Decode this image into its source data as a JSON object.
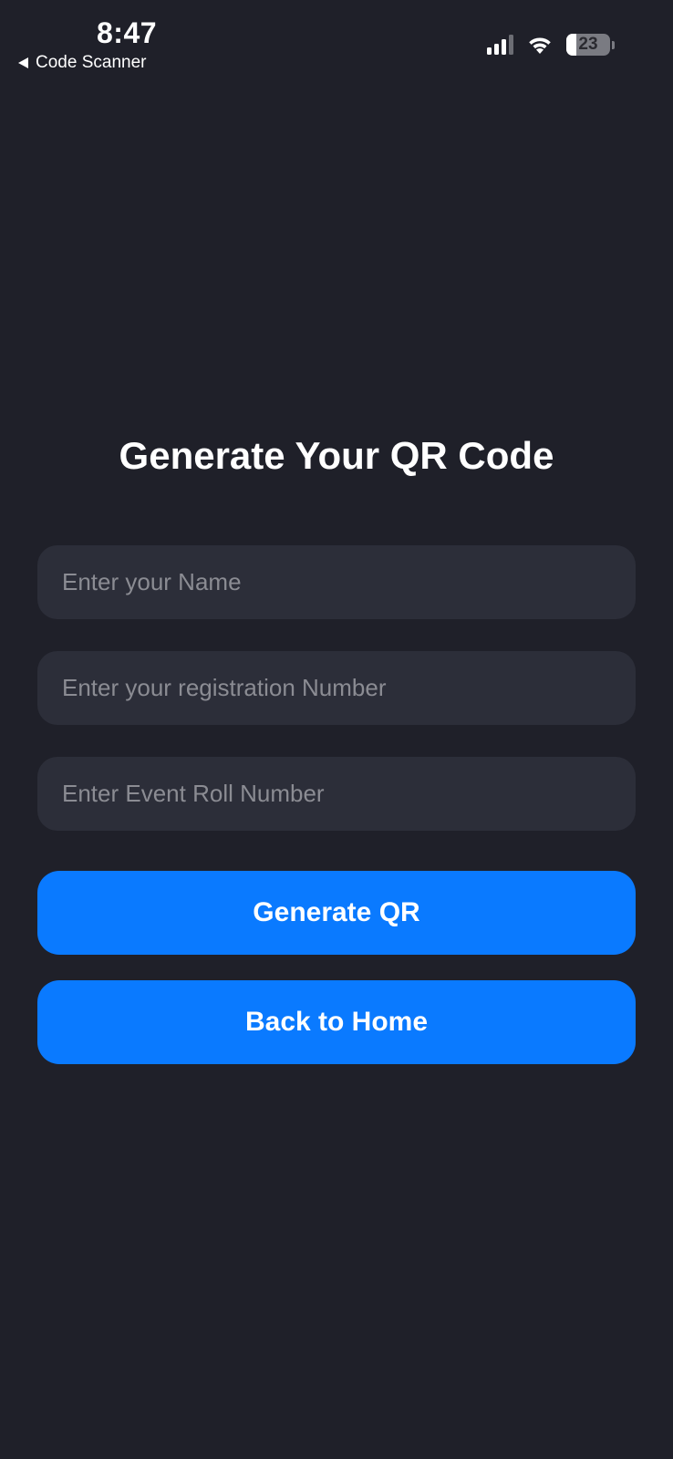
{
  "status_bar": {
    "time": "8:47",
    "back_app_label": "Code Scanner",
    "battery_level": "23",
    "battery_fraction": 0.23
  },
  "screen": {
    "title": "Generate Your QR Code",
    "fields": [
      {
        "placeholder": "Enter your Name",
        "value": ""
      },
      {
        "placeholder": "Enter your registration Number",
        "value": ""
      },
      {
        "placeholder": "Enter Event Roll Number",
        "value": ""
      }
    ],
    "buttons": {
      "generate": "Generate QR",
      "back_home": "Back to Home"
    }
  },
  "colors": {
    "background": "#1f2029",
    "field_background": "#2c2e39",
    "accent": "#0a7aff",
    "placeholder": "#8b8c93"
  },
  "icons": [
    "back-arrow-icon",
    "cellular-signal-icon",
    "wifi-icon",
    "battery-icon"
  ]
}
